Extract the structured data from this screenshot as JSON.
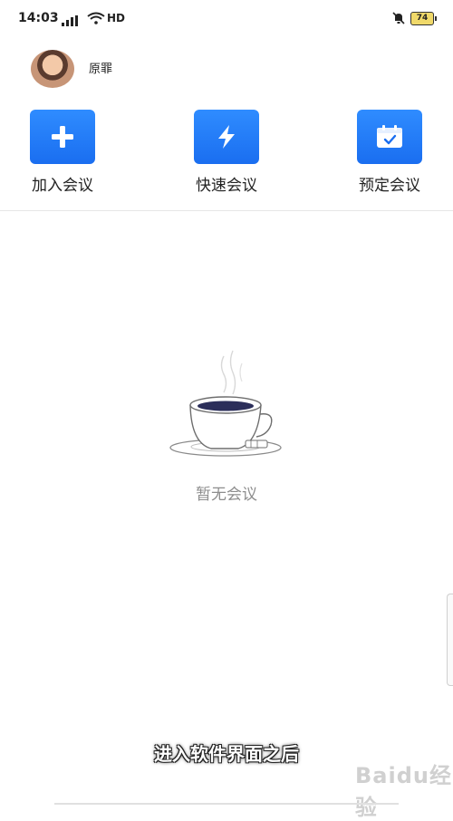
{
  "status_bar": {
    "time": "14:03",
    "network": "HD",
    "battery": "74"
  },
  "user": {
    "name": "原罪"
  },
  "actions": [
    {
      "label": "加入会议",
      "icon": "plus-icon"
    },
    {
      "label": "快速会议",
      "icon": "lightning-icon"
    },
    {
      "label": "预定会议",
      "icon": "calendar-check-icon"
    }
  ],
  "empty_state": {
    "text": "暂无会议",
    "illustration": "coffee-cup-icon"
  },
  "overlay": {
    "caption": "进入软件界面之后",
    "watermark": "Baidu经验"
  },
  "colors": {
    "accent": "#1a6ef0",
    "empty_text": "#8d8d8d"
  }
}
